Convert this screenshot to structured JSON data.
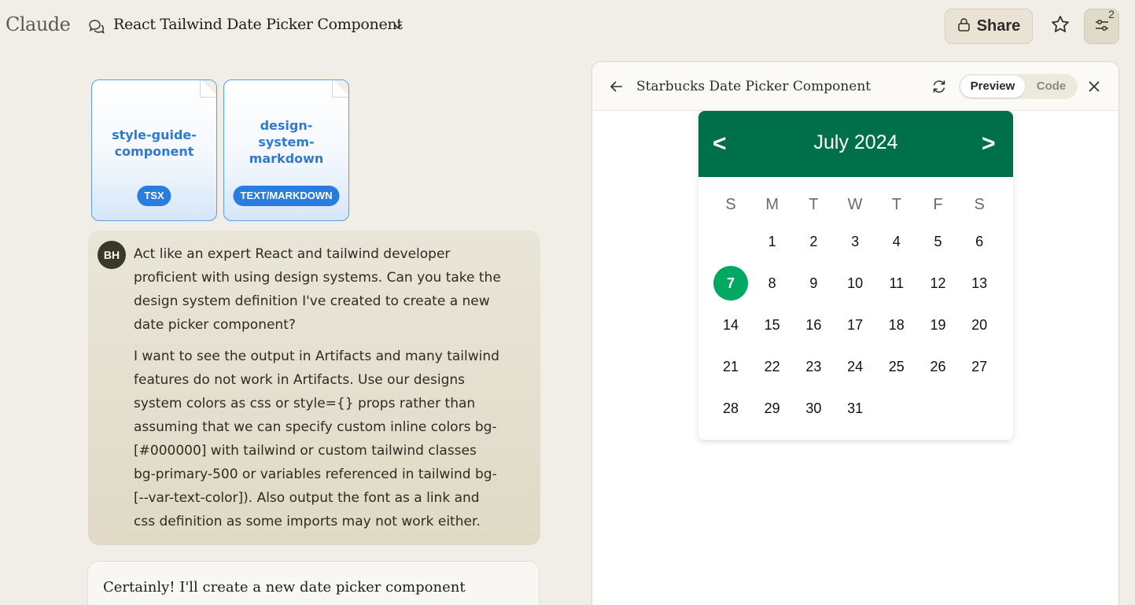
{
  "app": {
    "brand": "Claude"
  },
  "header": {
    "conversation_title": "React Tailwind Date Picker Component",
    "share_label": "Share",
    "settings_badge": "2"
  },
  "attachments": [
    {
      "name_lines": [
        "style-guide-",
        "component"
      ],
      "type": "TSX"
    },
    {
      "name_lines": [
        "design-",
        "system-",
        "markdown"
      ],
      "type": "TEXT/MARKDOWN"
    }
  ],
  "user_message": {
    "avatar_initials": "BH",
    "paragraph1": [
      "Act like an expert React and tailwind developer",
      "proficient with using design systems. Can you take the",
      "design system definition I've created to create a new",
      "date picker component?"
    ],
    "paragraph2": [
      "I want to see the output in Artifacts and many tailwind",
      "features do not work in Artifacts. Use our designs",
      "system colors as css or style={} props rather than",
      "assuming that we can specify custom inline colors bg-",
      "[#000000] with tailwind or custom tailwind classes",
      "bg-primary-500 or variables referenced in tailwind bg-",
      "[--var-text-color]). Also output the font as a link and",
      "css definition as some imports may not work either."
    ]
  },
  "assistant_message": {
    "text": "Certainly! I'll create a new date picker component"
  },
  "artifact": {
    "title": "Starbucks Date Picker Component",
    "preview_label": "Preview",
    "code_label": "Code",
    "active_view": "Preview"
  },
  "date_picker": {
    "prev_label": "<",
    "next_label": ">",
    "month_label": "July 2024",
    "weekdays": [
      "S",
      "M",
      "T",
      "W",
      "T",
      "F",
      "S"
    ],
    "first_weekday_index": 1,
    "days_in_month": 31,
    "selected_day": 7,
    "colors": {
      "header": "#00704a",
      "selected": "#00a862"
    }
  }
}
